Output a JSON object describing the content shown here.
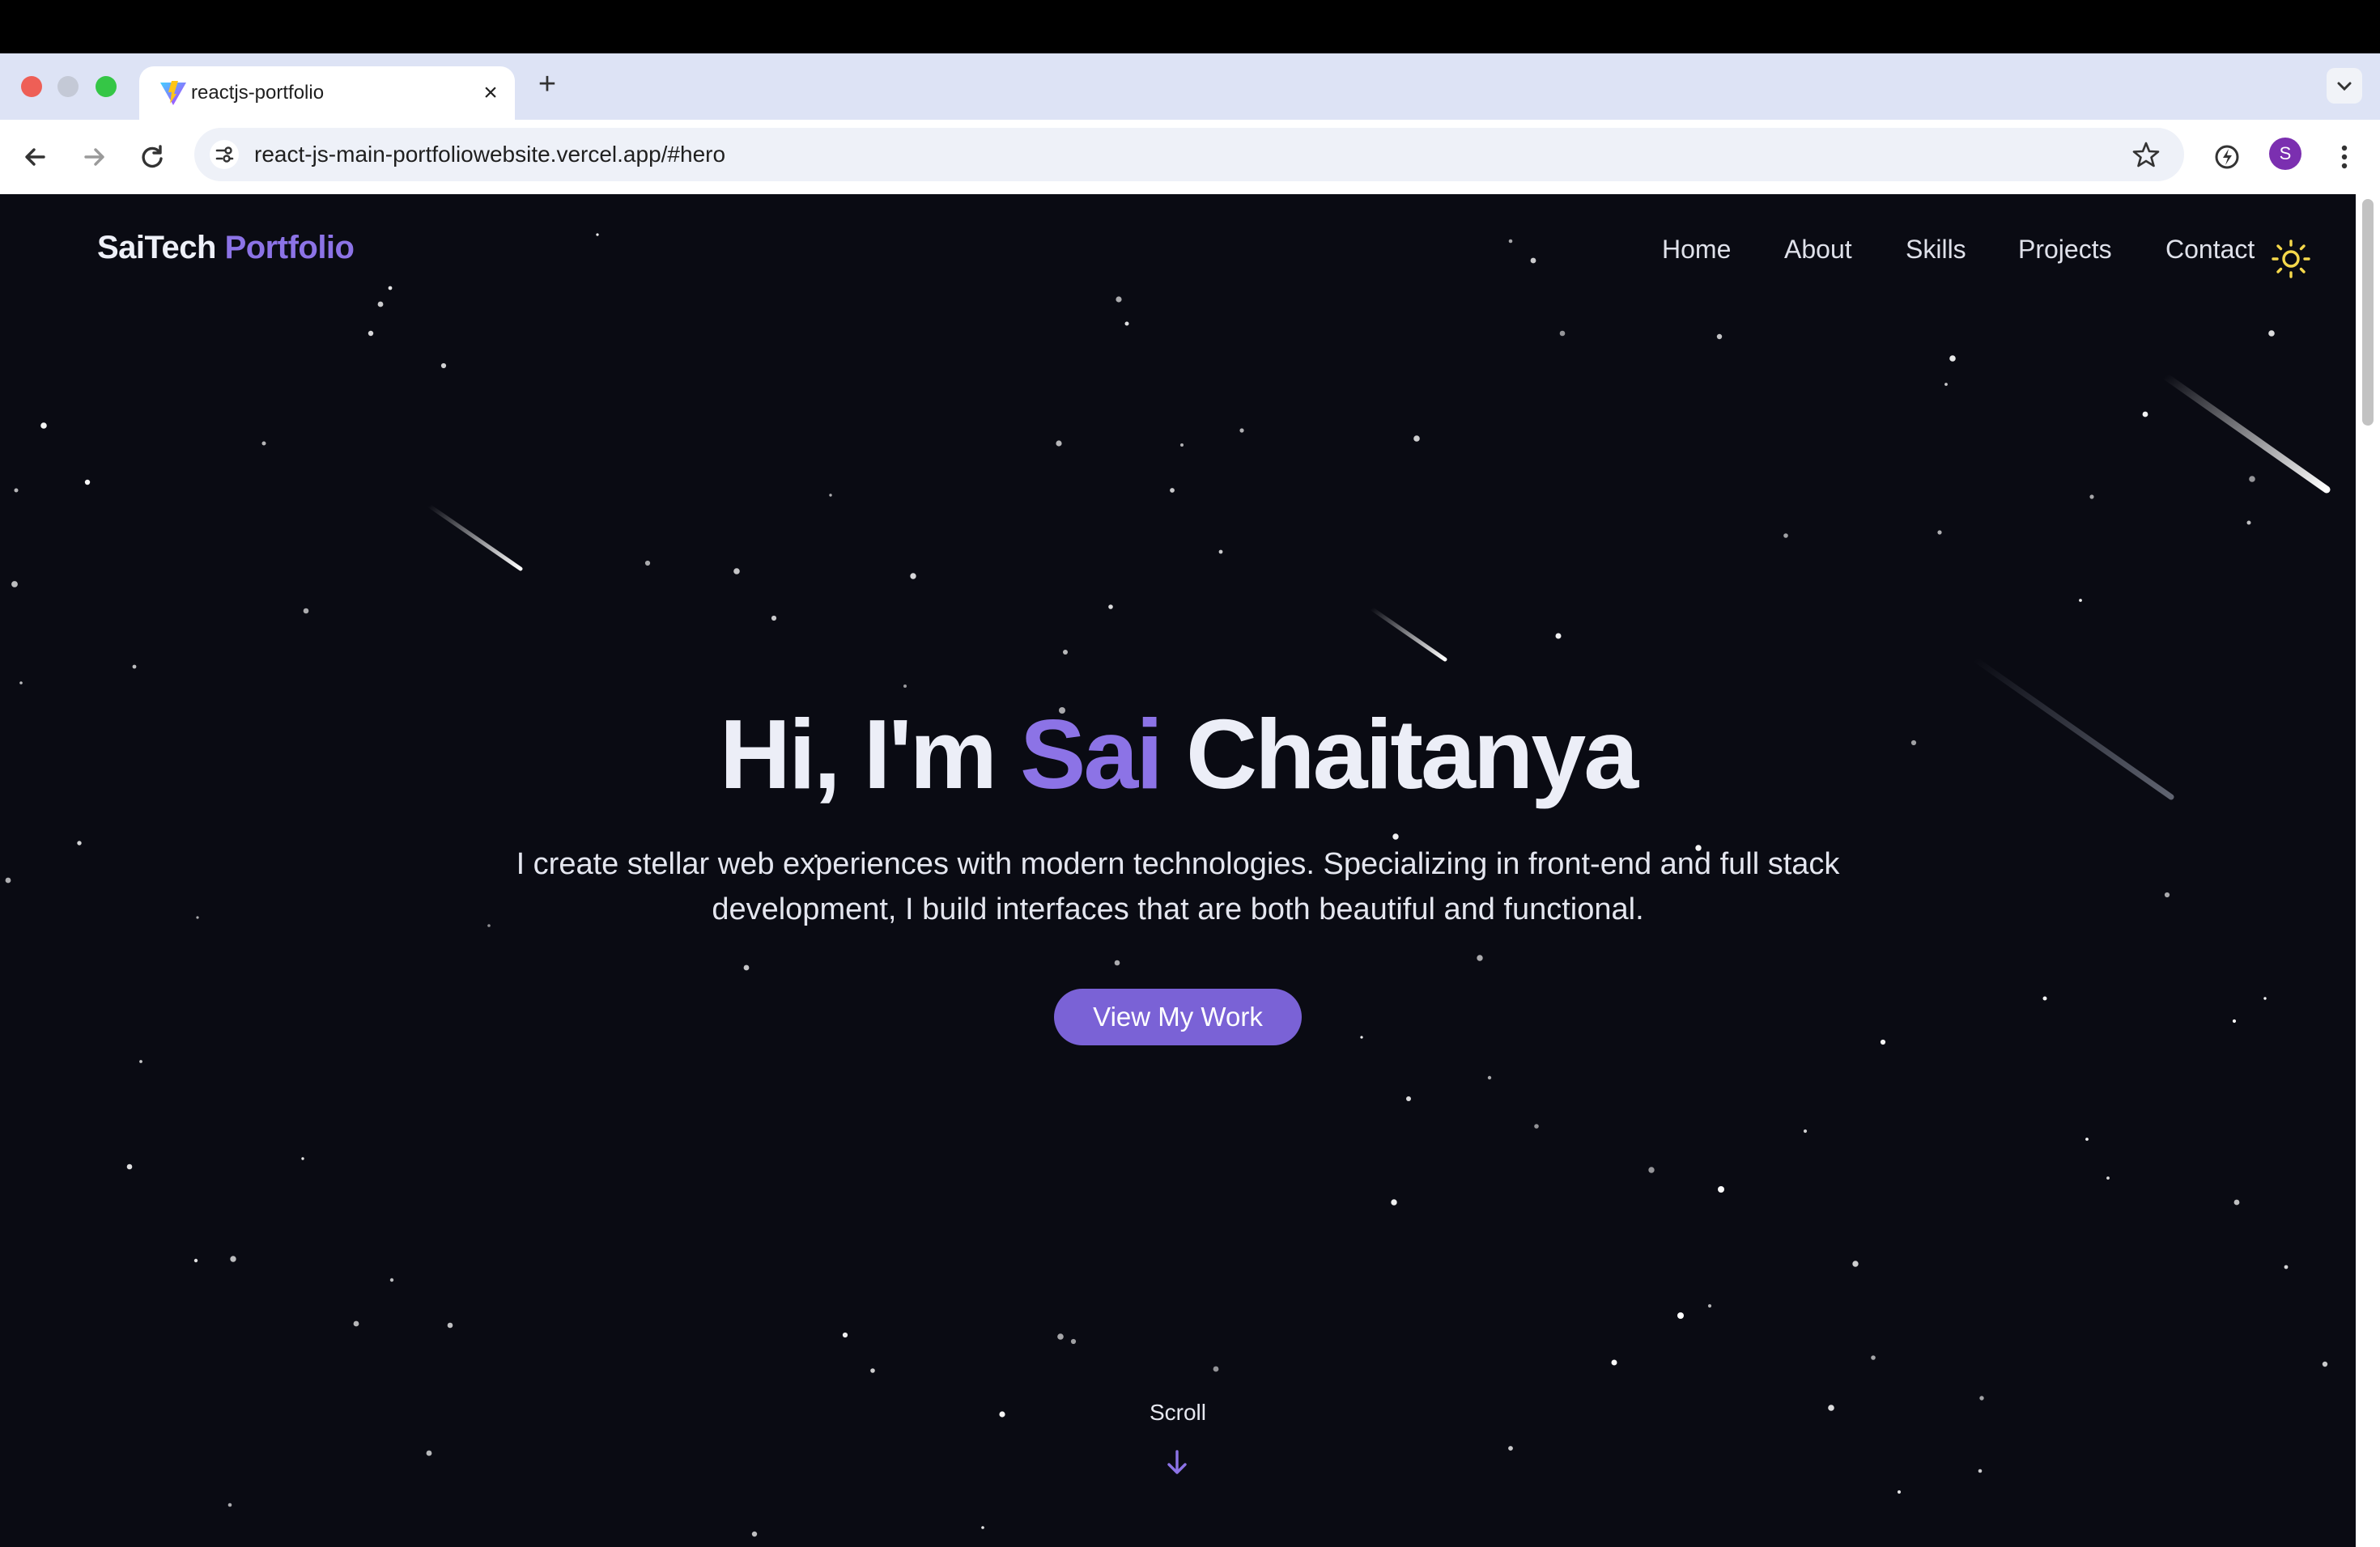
{
  "browser": {
    "tab_title": "reactjs-portfolio",
    "tab_close": "×",
    "new_tab": "+",
    "url": "react-js-main-portfoliowebsite.vercel.app/#hero",
    "profile_initial": "S"
  },
  "site": {
    "logo_main": "SaiTech",
    "logo_accent": "Portfolio",
    "nav": [
      "Home",
      "About",
      "Skills",
      "Projects",
      "Contact"
    ],
    "hero": {
      "greeting": "Hi, I'm",
      "first_name": "Sai",
      "last_name": "Chaitanya",
      "description": "I create stellar web experiences with modern technologies. Specializing in front-end and full stack development, I build interfaces that are both beautiful and functional.",
      "cta": "View My Work"
    },
    "scroll_label": "Scroll"
  },
  "colors": {
    "accent": "#8c73e6",
    "button": "#7a62d6",
    "background": "#0a0b13",
    "sun": "#f5d84b"
  },
  "icons": [
    "back-icon",
    "forward-icon",
    "reload-icon",
    "site-settings-icon",
    "star-icon",
    "extension-icon",
    "kebab-menu-icon",
    "sun-icon",
    "arrow-down-icon"
  ]
}
